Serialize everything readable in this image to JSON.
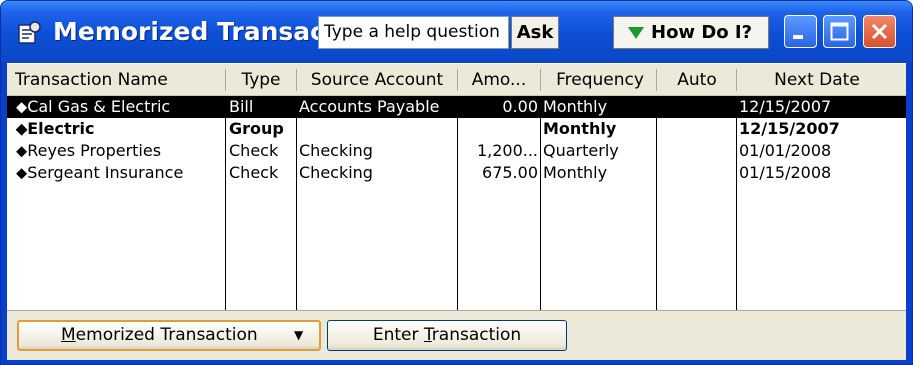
{
  "window": {
    "title": "Memorized Transactio...",
    "help_placeholder": "Type a help question",
    "ask_label": "Ask",
    "howdoi_label": "How Do I?",
    "accent_color": "#0b46c6"
  },
  "table": {
    "columns": [
      "Transaction Name",
      "Type",
      "Source Account",
      "Amo...",
      "Frequency",
      "Auto",
      "Next Date"
    ],
    "rows": [
      {
        "name": "Cal Gas & Electric",
        "type": "Bill",
        "account": "Accounts Payable",
        "amount": "0.00",
        "frequency": "Monthly",
        "auto": "",
        "next_date": "12/15/2007",
        "selected": true,
        "bold": false
      },
      {
        "name": "Electric",
        "type": "Group",
        "account": "",
        "amount": "",
        "frequency": "Monthly",
        "auto": "",
        "next_date": "12/15/2007",
        "selected": false,
        "bold": true
      },
      {
        "name": "Reyes Properties",
        "type": "Check",
        "account": "Checking",
        "amount": "1,200...",
        "frequency": "Quarterly",
        "auto": "",
        "next_date": "01/01/2008",
        "selected": false,
        "bold": false
      },
      {
        "name": "Sergeant Insurance",
        "type": "Check",
        "account": "Checking",
        "amount": "675.00",
        "frequency": "Monthly",
        "auto": "",
        "next_date": "01/15/2008",
        "selected": false,
        "bold": false
      }
    ],
    "row_bullet": "⬥"
  },
  "buttons": {
    "memorized_prefix": "",
    "memorized_underlined": "M",
    "memorized_rest": "emorized Transaction",
    "memorized_arrow": "▼",
    "enter_prefix": "Enter ",
    "enter_underlined": "T",
    "enter_rest": "ransaction"
  }
}
